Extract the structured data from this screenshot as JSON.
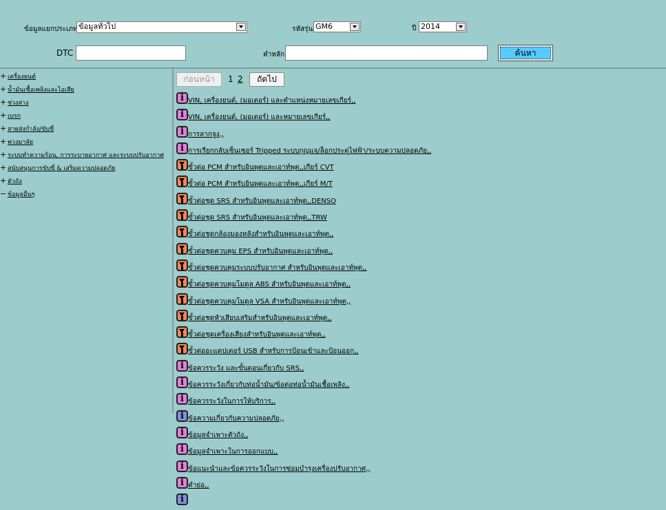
{
  "filters": {
    "category_label": "ข้อมูลแยกประเภท",
    "category_value": "ข้อมูลทั่วไป",
    "model_label": "รหัสรุ่น",
    "model_value": "GM6",
    "year_label": "ปี",
    "year_value": "2014",
    "dtc_label": "DTC",
    "dtc_value": "",
    "keyword_label": "คำหลัก",
    "keyword_value": "",
    "search_label": "ค้นหา"
  },
  "sidebar": {
    "items": [
      {
        "sign": "+",
        "label": "เครื่องยนต์"
      },
      {
        "sign": "+",
        "label": "น้ำมันเชื้อเพลิงและไอเสีย"
      },
      {
        "sign": "+",
        "label": "ช่วงล่าง"
      },
      {
        "sign": "+",
        "label": "เบรก"
      },
      {
        "sign": "+",
        "label": "สายส่งกำลัง/ขับขี่"
      },
      {
        "sign": "+",
        "label": "พวงมาลัย"
      },
      {
        "sign": "+",
        "label": "ระบบทำความร้อน, การระบายอากาศ และระบบปรับอากาศ"
      },
      {
        "sign": "+",
        "label": "สนับสนุนการขับขี่ & เสริมความปลอดภัย"
      },
      {
        "sign": "+",
        "label": "ตัวถัง"
      },
      {
        "sign": "−",
        "label": "ข้อมูลอื่นๆ"
      }
    ]
  },
  "pager": {
    "prev_label": "ก่อนหน้า",
    "current_page": "1",
    "page2": "2",
    "next_label": "ถัดไป"
  },
  "documents": [
    {
      "icon": "info",
      "title": "VIN, เครื่องยนต์, (มอเตอร์) และตำแหน่งหมายเลขเกียร์,,"
    },
    {
      "icon": "info",
      "title": "VIN, เครื่องยนต์, (มอเตอร์) และหมายเลขเกียร์,,"
    },
    {
      "icon": "info",
      "title": "การลากจูง,,"
    },
    {
      "icon": "info",
      "title": "การเรียกกลับเซ็นเซอร์ Tripped ระบบกุญแจ/ล็อกประตูไฟฟ้า/ระบบความปลอดภัย,,"
    },
    {
      "icon": "connector",
      "title": "ขั้วต่อ PCM สำหรับอินพุตและเอาท์พุต,,เกียร์ CVT"
    },
    {
      "icon": "connector",
      "title": "ขั้วต่อ PCM สำหรับอินพุตและเอาท์พุต,,เกียร์ M/T"
    },
    {
      "icon": "connector",
      "title": "ขั้วต่อชุด SRS สำหรับอินพุตและเอาท์พุต,,DENSO"
    },
    {
      "icon": "connector",
      "title": "ขั้วต่อชุด SRS สำหรับอินพุตและเอาท์พุต,,TRW"
    },
    {
      "icon": "connector",
      "title": "ขั้วต่อชุดกล้องมองหลังสำหรับอินพุตและเอาท์พุต,,"
    },
    {
      "icon": "connector",
      "title": "ขั้วต่อชุดควบคุม EPS สำหรับอินพุตและเอาท์พุต,,"
    },
    {
      "icon": "connector",
      "title": "ขั้วต่อชุดควบคุมระบบปรับอากาศ สำหรับอินพุตและเอาท์พุต,,"
    },
    {
      "icon": "connector",
      "title": "ขั้วต่อชุดควบคุมโมดูล ABS สำหรับอินพุตและเอาท์พุต,,"
    },
    {
      "icon": "connector",
      "title": "ขั้วต่อชุดควบคุมโมดูล VSA สำหรับอินพุตและเอาท์พุต,,"
    },
    {
      "icon": "connector",
      "title": "ขั้วต่อชุดหัวเสียบเสริมสำหรับอินพุตและเอาท์พุต,,"
    },
    {
      "icon": "connector",
      "title": "ขั้วต่อชุดเครื่องเสียงสำหรับอินพุตและเอาท์พุต,,"
    },
    {
      "icon": "connector",
      "title": "ขั้วต่ออะแดปเตอร์ USB สำหรับการป้อนเข้าและป้อนออก,,"
    },
    {
      "icon": "info",
      "title": "ข้อควรระวัง และขั้นตอนเกี่ยวกับ SRS,,"
    },
    {
      "icon": "info",
      "title": "ข้อควรระวังเกี่ยวกับท่อน้ำมัน/ข้อต่อท่อน้ำมันเชื้อเพลิง,,"
    },
    {
      "icon": "info",
      "title": "ข้อควรระวังในการให้บริการ,,"
    },
    {
      "icon": "info-blue",
      "title": "ข้อความเกี่ยวกับความปลอดภัย,,"
    },
    {
      "icon": "info",
      "title": "ข้อมูลจำเพาะตัวถัง,,"
    },
    {
      "icon": "info",
      "title": "ข้อมูลจำเพาะในการออกแบบ,,"
    },
    {
      "icon": "info",
      "title": "ข้อแนะนำและข้อควรระวังในการซ่อมบำรุงเครื่องปรับอากาศ,,"
    },
    {
      "icon": "info",
      "title": "คำย่อ,,"
    },
    {
      "icon": "info-blue",
      "title": ""
    }
  ]
}
